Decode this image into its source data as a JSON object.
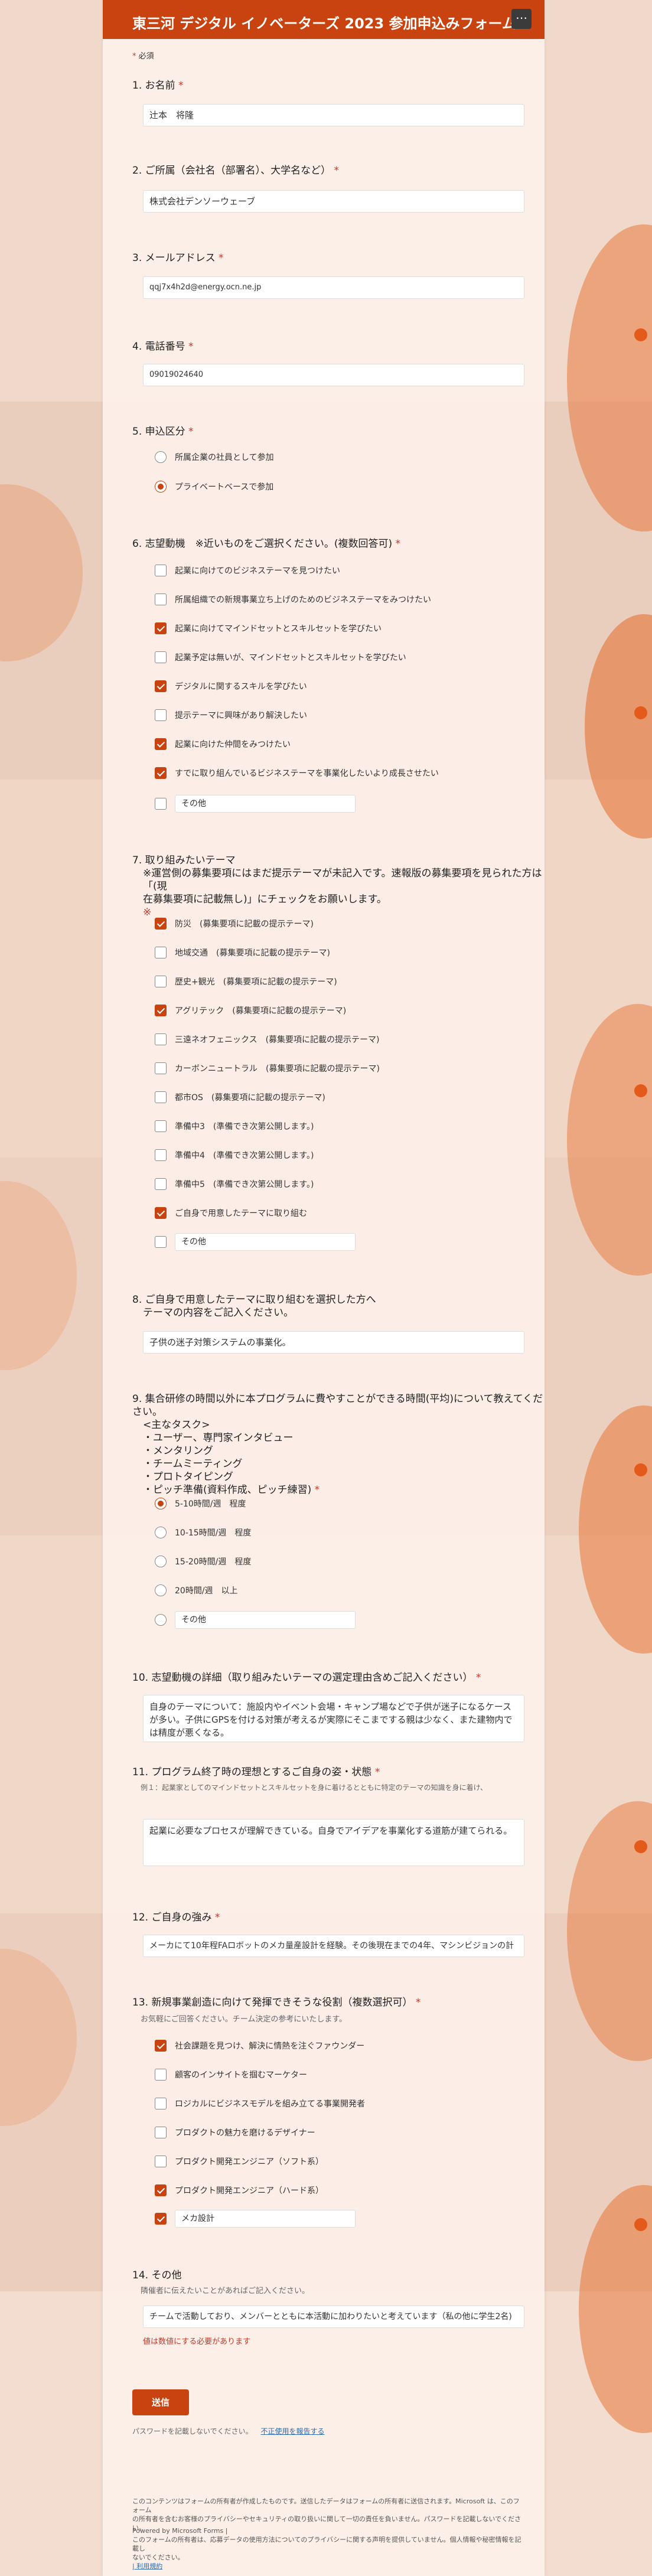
{
  "form": {
    "title": "東三河 デジタル イノベーターズ 2023 参加申込みフォーム",
    "menu_icon": "more-icon",
    "required_note_star": "*",
    "required_note": "必須",
    "accent_color": "#c8430f"
  },
  "questions": {
    "q1": {
      "label": "1. お名前",
      "value": "辻本　将隆"
    },
    "q2": {
      "label": "2. ご所属（会社名（部署名）、大学名など）",
      "value": "株式会社デンソーウェーブ"
    },
    "q3": {
      "label": "3. メールアドレス",
      "value": "qqj7x4h2d@energy.ocn.ne.jp"
    },
    "q4": {
      "label": "4. 電話番号",
      "value": "09019024640"
    },
    "q5": {
      "label": "5. 申込区分",
      "options": [
        {
          "label": "所属企業の社員として参加",
          "checked": false
        },
        {
          "label": "プライベートベースで参加",
          "checked": true
        }
      ]
    },
    "q6": {
      "label": "6. 志望動機　※近いものをご選択ください。(複数回答可)",
      "options": [
        {
          "label": "起業に向けてのビジネステーマを見つけたい",
          "checked": false
        },
        {
          "label": "所属組織での新規事業立ち上げのためのビジネステーマをみつけたい",
          "checked": false
        },
        {
          "label": "起業に向けてマインドセットとスキルセットを学びたい",
          "checked": true
        },
        {
          "label": "起業予定は無いが、マインドセットとスキルセットを学びたい",
          "checked": false
        },
        {
          "label": "デジタルに関するスキルを学びたい",
          "checked": true
        },
        {
          "label": "提示テーマに興味があり解決したい",
          "checked": false
        },
        {
          "label": "起業に向けた仲間をみつけたい",
          "checked": true
        },
        {
          "label": "すでに取り組んでいるビジネステーマを事業化したいより成長させたい",
          "checked": true
        }
      ],
      "other_label": "その他",
      "other_value": ""
    },
    "q7": {
      "label_line1": "7. 取り組みたいテーマ",
      "label_line2": "※運営側の募集要項にはまだ提示テーマが未記入です。速報版の募集要項を見られた方は「(現",
      "label_line3": "在募集要項に記載無し)」にチェックをお願いします。",
      "label_line4": "※",
      "options": [
        {
          "label": "防災　(募集要項に記載の提示テーマ)",
          "checked": true
        },
        {
          "label": "地域交通　(募集要項に記載の提示テーマ)",
          "checked": false
        },
        {
          "label": "歴史+観光　(募集要項に記載の提示テーマ)",
          "checked": false
        },
        {
          "label": "アグリテック　(募集要項に記載の提示テーマ)",
          "checked": true
        },
        {
          "label": "三遠ネオフェニックス　(募集要項に記載の提示テーマ)",
          "checked": false
        },
        {
          "label": "カーボンニュートラル　(募集要項に記載の提示テーマ)",
          "checked": false
        },
        {
          "label": "都市OS　(募集要項に記載の提示テーマ)",
          "checked": false
        },
        {
          "label": "準備中3　(準備でき次第公開します。)",
          "checked": false
        },
        {
          "label": "準備中4　(準備でき次第公開します。)",
          "checked": false
        },
        {
          "label": "準備中5　(準備でき次第公開します。)",
          "checked": false
        },
        {
          "label": "ご自身で用意したテーマに取り組む",
          "checked": true
        }
      ],
      "other_label": "その他",
      "other_value": ""
    },
    "q8": {
      "label_line1": "8. ご自身で用意したテーマに取り組むを選択した方へ",
      "label_line2": "テーマの内容をご記入ください。",
      "value": "子供の迷子対策システムの事業化。"
    },
    "q9": {
      "label_lines": [
        "9. 集合研修の時間以外に本プログラムに費やすことができる時間(平均)について教えてください。",
        "<主なタスク>",
        "・ユーザー、専門家インタビュー",
        "・メンタリング",
        "・チームミーティング",
        "・プロトタイピング",
        "・ピッチ準備(資料作成、ピッチ練習)"
      ],
      "options": [
        {
          "label": "5-10時間/週　程度",
          "checked": true
        },
        {
          "label": "10-15時間/週　程度",
          "checked": false
        },
        {
          "label": "15-20時間/週　程度",
          "checked": false
        },
        {
          "label": "20時間/週　以上",
          "checked": false
        }
      ],
      "other_label": "その他",
      "other_value": ""
    },
    "q10": {
      "label": "10. 志望動機の詳細（取り組みたいテーマの選定理由含めご記入ください）",
      "value": "自身のテーマについて：施設内やイベント会場・キャンプ場などで子供が迷子になるケースが多い。子供にGPSを付ける対策が考えるが実際にそこまでする親は少なく、また建物内では精度が悪くなる。"
    },
    "q11": {
      "label": "11. プログラム終了時の理想とするご自身の姿・状態",
      "sub": "例１：起業家としてのマインドセットとスキルセットを身に着けるとともに特定のテーマの知識を身に着け、",
      "value": "起業に必要なプロセスが理解できている。自身でアイデアを事業化する道筋が建てられる。"
    },
    "q12": {
      "label": "12. ご自身の強み",
      "value": "メーカにて10年程FAロボットのメカ量産設計を経験。その後現在までの4年、マシンビジョンの計"
    },
    "q13": {
      "label": "13. 新規事業創造に向けて発揮できそうな役割（複数選択可）",
      "sub": "お気軽にご回答ください。チーム決定の参考にいたします。",
      "options": [
        {
          "label": "社会課題を見つけ、解決に情熱を注ぐファウンダー",
          "checked": true
        },
        {
          "label": "顧客のインサイトを掴むマーケター",
          "checked": false
        },
        {
          "label": "ロジカルにビジネスモデルを組み立てる事業開発者",
          "checked": false
        },
        {
          "label": "プロダクトの魅力を磨けるデザイナー",
          "checked": false
        },
        {
          "label": "プロダクト開発エンジニア（ソフト系）",
          "checked": false
        },
        {
          "label": "プロダクト開発エンジニア（ハード系）",
          "checked": true
        }
      ],
      "other_value": "メカ設計"
    },
    "q14": {
      "label": "14. その他",
      "sub": "隣催者に伝えたいことがあればご記入ください。",
      "value": "チームで活動しており、メンバーとともに本活動に加わりたいと考えています（私の他に学生2名)",
      "error": "値は数値にする必要があります"
    }
  },
  "submit_label": "送信",
  "password_note": "パスワードを記載しないでください。",
  "report_link": "不正使用を報告する",
  "footer": {
    "line1": "このコンテンツはフォームの所有者が作成したものです。送信したデータはフォームの所有者に送信されます。Microsoft は、このフォーム",
    "line2": "の所有者を含むお客様のプライバシーやセキュリティの取り扱いに関して一切の責任を負いません。パスワードを記載しないでください。",
    "line3": "Powered by Microsoft Forms |",
    "line4": "このフォームの所有者は、応募データの使用方法についてのプライバシーに関する声明を提供していません。個人情報や秘密情報を記載し",
    "line5": "ないでください。",
    "line6": "| 利用規約"
  },
  "required_star": "*"
}
